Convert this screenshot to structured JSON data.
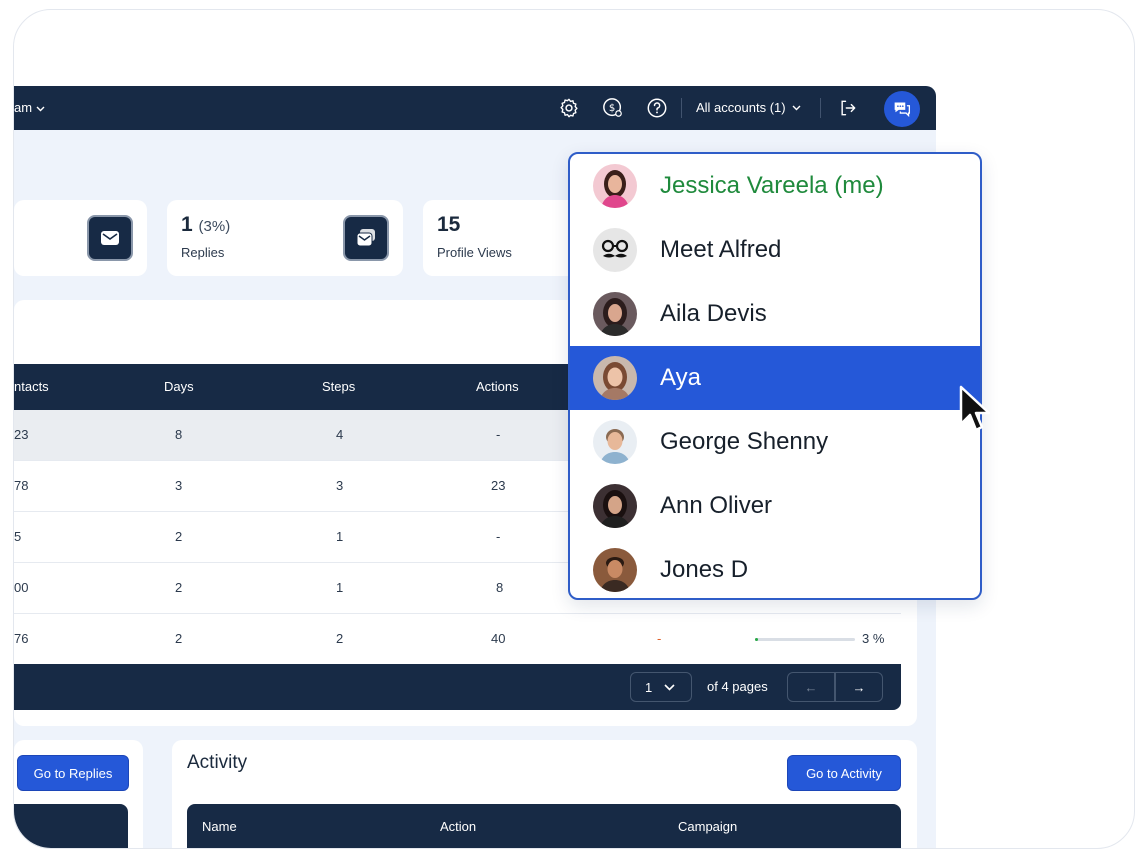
{
  "topbar": {
    "team_label": "am",
    "accounts_label": "All accounts (1)",
    "icons": [
      "gear-icon",
      "billing-icon",
      "help-icon",
      "logout-icon",
      "chat-icon"
    ]
  },
  "stats": [
    {
      "value": "1",
      "pct": "(3%)",
      "label": "Replies"
    },
    {
      "value": "15",
      "pct": "",
      "label": "Profile Views"
    }
  ],
  "table": {
    "headers": [
      "ntacts",
      "Days",
      "Steps",
      "Actions"
    ],
    "rows": [
      [
        "23",
        "8",
        "4",
        "-"
      ],
      [
        "78",
        "3",
        "3",
        "23"
      ],
      [
        "5",
        "2",
        "1",
        "-"
      ],
      [
        "00",
        "2",
        "1",
        "8"
      ],
      [
        "76",
        "2",
        "2",
        "40"
      ]
    ],
    "last_row_extra": {
      "dash": "-",
      "progress_pct": 3,
      "progress_label": "3 %"
    },
    "pagination": {
      "current": "1",
      "of_pages": "of 4 pages",
      "prev": "←",
      "next": "→"
    }
  },
  "replies_panel": {
    "button": "Go to Replies"
  },
  "activity": {
    "title": "Activity",
    "button": "Go to Activity",
    "headers": [
      "Name",
      "Action",
      "Campaign"
    ]
  },
  "dropdown": {
    "items": [
      {
        "name": "Jessica Vareela (me)",
        "me": true
      },
      {
        "name": "Meet Alfred"
      },
      {
        "name": "Aila Devis"
      },
      {
        "name": "Aya",
        "selected": true
      },
      {
        "name": "George Shenny"
      },
      {
        "name": "Ann Oliver"
      },
      {
        "name": "Jones D"
      }
    ]
  },
  "colors": {
    "navy": "#172a45",
    "accent_blue": "#2558d8",
    "me_green": "#1f8a3c",
    "progress_green": "#27a845",
    "dash_orange": "#e0612a"
  }
}
